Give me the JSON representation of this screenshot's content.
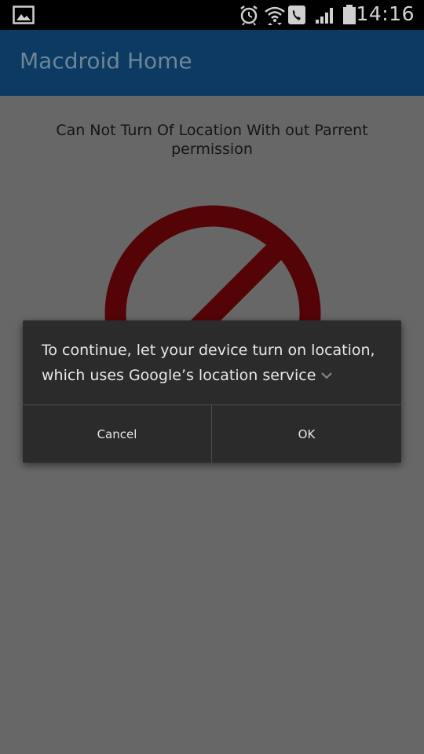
{
  "status_bar": {
    "time": "14:16",
    "icons": [
      "gallery-icon",
      "alarm-icon",
      "wifi-icon",
      "phone-icon",
      "signal-icon",
      "battery-icon"
    ]
  },
  "app_bar": {
    "title": "Macdroid Home",
    "color": "#0c3a63"
  },
  "main": {
    "message": "Can Not Turn Of Location With out Parrent permission",
    "prohibited_icon_color": "#540407"
  },
  "dialog": {
    "text": "To continue, let your device turn on location, which uses Google’s location service",
    "cancel_label": "Cancel",
    "ok_label": "OK"
  }
}
